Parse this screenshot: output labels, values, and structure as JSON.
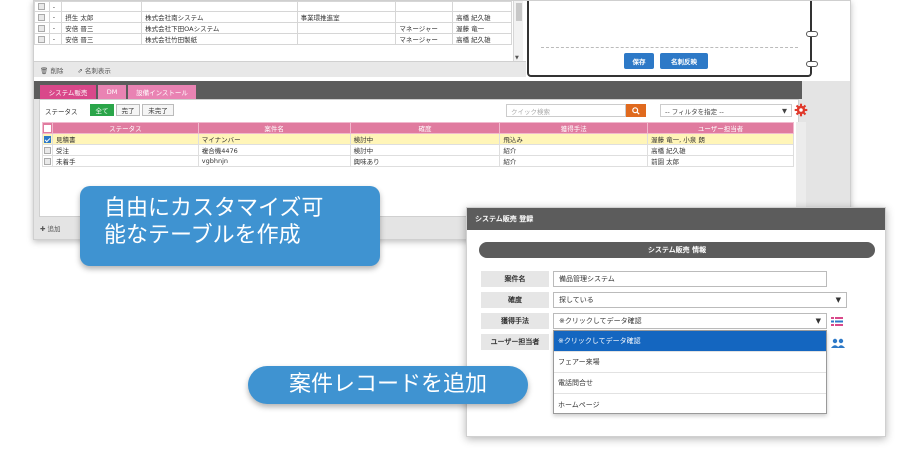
{
  "upper_table": {
    "rows": [
      {
        "dash": "-",
        "name": "",
        "company": "",
        "dept": "",
        "title": "",
        "owner": ""
      },
      {
        "dash": "-",
        "name": "摂生 太郎",
        "company": "株式会社南システム",
        "dept": "事業環推進室",
        "title": "",
        "owner": "高橋 紀久雄"
      },
      {
        "dash": "-",
        "name": "安倍 晋三",
        "company": "株式会社下田OAシステム",
        "dept": "",
        "title": "マネージャー",
        "owner": "渥藤 竜一"
      },
      {
        "dash": "-",
        "name": "安倍 晋三",
        "company": "株式会社竹田製紙",
        "dept": "",
        "title": "マネージャー",
        "owner": "高橋 紀久雄"
      }
    ],
    "footer": {
      "delete": "削除",
      "show_name": "名刺表示"
    }
  },
  "card": {
    "save": "保存",
    "apply": "名刺反映"
  },
  "module": {
    "tabs": [
      "システム販売",
      "DM",
      "設備インストール"
    ],
    "status_label": "ステータス",
    "status_buttons": [
      "全て",
      "完了",
      "未完了"
    ],
    "search_placeholder": "クイック検索",
    "filter_label": "-- フィルタを指定 --",
    "columns": [
      "ステータス",
      "案件名",
      "確度",
      "獲得手法",
      "ユーザー担当者"
    ],
    "rows": [
      {
        "status": "見積書",
        "case": "マイナンバー",
        "certainty": "検討中",
        "method": "飛込み",
        "user": "渥藤 竜一, 小泉 朗",
        "selected": true
      },
      {
        "status": "受注",
        "case": "複合機4476",
        "certainty": "検討中",
        "method": "紹介",
        "user": "高橋 紀久雄",
        "selected": false
      },
      {
        "status": "未着手",
        "case": "vgbhnjn",
        "certainty": "興味あり",
        "method": "紹介",
        "user": "前園 太郎",
        "selected": false
      }
    ],
    "footer_add": "追加"
  },
  "callouts": {
    "line1": "自由にカスタマイズ可",
    "line2": "能なテーブルを作成",
    "add_record": "案件レコードを追加"
  },
  "dialog": {
    "title": "システム販売 登録",
    "section": "システム販売 情報",
    "fields": {
      "case_label": "案件名",
      "case_value": "備品管理システム",
      "certainty_label": "確度",
      "certainty_value": "探している",
      "method_label": "獲得手法",
      "method_value": "※クリックしてデータ確認",
      "user_label": "ユーザー担当者"
    },
    "dropdown_options": [
      "※クリックしてデータ確認",
      "フェアー来場",
      "電話問合せ",
      "ホームページ"
    ]
  },
  "colors": {
    "accent_pink": "#d9488a",
    "table_header": "#e07b9f",
    "blue": "#2d79c7",
    "green": "#2aa549",
    "search_orange": "#e06a1e"
  }
}
